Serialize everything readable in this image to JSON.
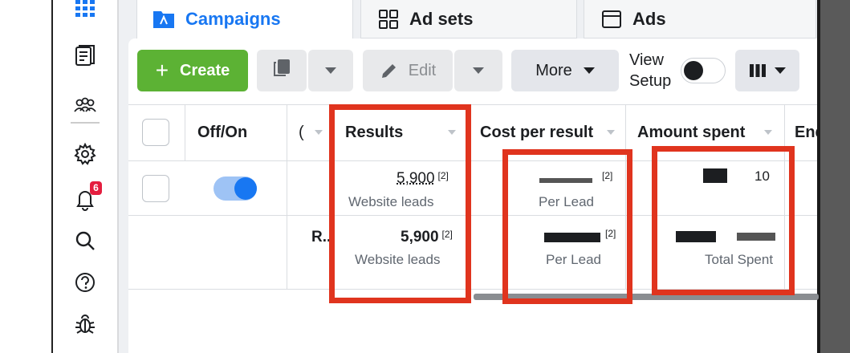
{
  "tabs": [
    {
      "label": "Campaigns",
      "icon": "campaigns-icon",
      "active": true
    },
    {
      "label": "Ad sets",
      "icon": "adsets-grid-icon",
      "active": false
    },
    {
      "label": "Ads",
      "icon": "ads-window-icon",
      "active": false
    }
  ],
  "toolbar": {
    "create_label": "Create",
    "edit_label": "Edit",
    "more_label": "More",
    "view_setup_line1": "View",
    "view_setup_line2": "Setup",
    "view_setup_on": false
  },
  "columns": {
    "off_on": "Off/On",
    "campaign_name_truncated": "(",
    "results": "Results",
    "cost_per_result": "Cost per result",
    "amount_spent": "Amount spent",
    "ends_truncated": "End"
  },
  "rows": [
    {
      "toggle_on": true,
      "results_value": "5,900",
      "results_footnote": "[2]",
      "results_label": "Website leads",
      "cost_footnote": "[2]",
      "cost_label": "Per Lead",
      "amount_partial": "10"
    }
  ],
  "summary_row": {
    "name_truncated": "R...",
    "results_value": "5,900",
    "results_footnote": "[2]",
    "results_label": "Website leads",
    "cost_footnote": "[2]",
    "cost_label": "Per Lead",
    "amount_label": "Total Spent"
  },
  "nav": {
    "notification_count": "6",
    "icons": [
      "grid-menu-icon",
      "pages-icon",
      "audience-icon",
      "settings-icon",
      "notifications-icon",
      "search-icon",
      "help-icon",
      "bug-report-icon"
    ]
  },
  "colors": {
    "accent": "#1877f2",
    "create_green": "#5cb234",
    "highlight_red": "#e0341e",
    "badge_red": "#e41e3f"
  }
}
